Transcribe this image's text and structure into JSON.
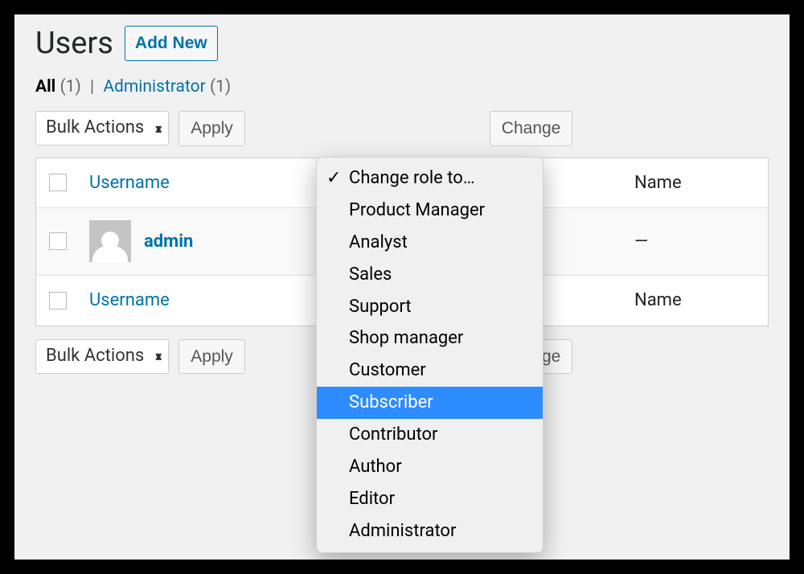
{
  "header": {
    "title": "Users",
    "add_new": "Add New"
  },
  "filters": {
    "all_label": "All",
    "all_count": "(1)",
    "admin_label": "Administrator",
    "admin_count": "(1)"
  },
  "controls": {
    "bulk_actions": "Bulk Actions",
    "apply": "Apply",
    "change": "Change"
  },
  "role_dropdown": {
    "selected_index": 0,
    "highlight_index": 7,
    "options": [
      "Change role to…",
      "Product Manager",
      "Analyst",
      "Sales",
      "Support",
      "Shop manager",
      "Customer",
      "Subscriber",
      "Contributor",
      "Author",
      "Editor",
      "Administrator"
    ]
  },
  "table": {
    "col_username": "Username",
    "col_name": "Name",
    "rows": [
      {
        "username": "admin",
        "name": "—"
      }
    ]
  }
}
